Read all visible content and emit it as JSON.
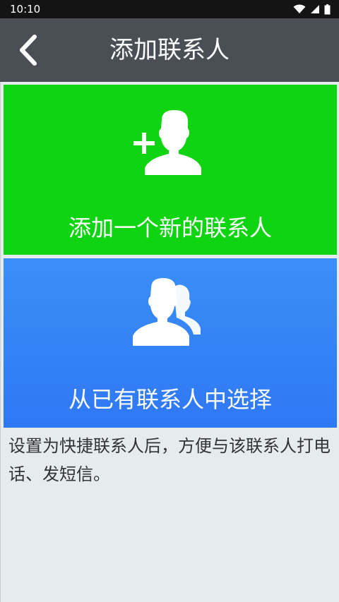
{
  "status_bar": {
    "time": "10:10",
    "icons": [
      "wifi-icon",
      "cellular-signal-icon",
      "battery-icon"
    ]
  },
  "app_bar": {
    "back_icon": "chevron-left-icon",
    "title": "添加联系人"
  },
  "cards": {
    "add_new": {
      "label": "添加一个新的联系人",
      "icon": "add-person-icon",
      "background": "#0fd411"
    },
    "pick_existing": {
      "label": "从已有联系人中选择",
      "icon": "contacts-icon",
      "background": "#2f80f6"
    }
  },
  "hint": "设置为快捷联系人后，方便与该联系人打电话、发短信。",
  "colors": {
    "status_bar": "#141414",
    "app_bar": "#4a4e55",
    "page_background": "#e6ebee"
  }
}
